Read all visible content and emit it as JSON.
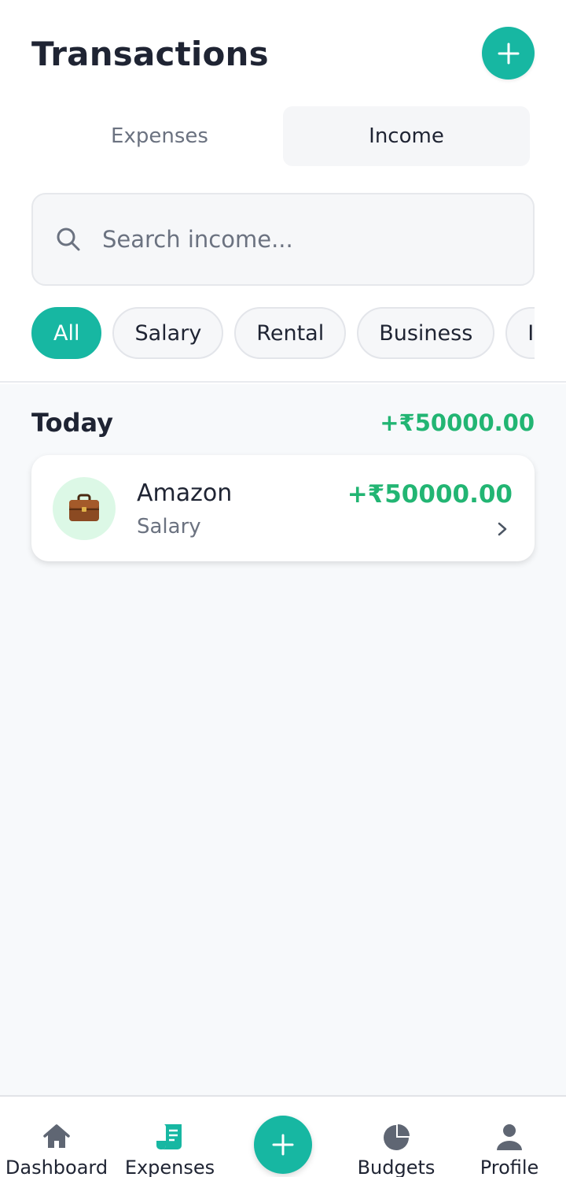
{
  "header": {
    "title": "Transactions",
    "add_icon": "plus-icon"
  },
  "tabs": [
    {
      "label": "Expenses",
      "active": false
    },
    {
      "label": "Income",
      "active": true
    }
  ],
  "search": {
    "placeholder": "Search income...",
    "value": "",
    "icon": "search-icon"
  },
  "filters": [
    {
      "label": "All",
      "active": true
    },
    {
      "label": "Salary",
      "active": false
    },
    {
      "label": "Rental",
      "active": false
    },
    {
      "label": "Business",
      "active": false
    },
    {
      "label": "In",
      "active": false
    }
  ],
  "groups": [
    {
      "title": "Today",
      "total": "+₹50000.00",
      "transactions": [
        {
          "name": "Amazon",
          "category": "Salary",
          "amount": "+₹50000.00",
          "icon": "briefcase-icon"
        }
      ]
    }
  ],
  "bottom_nav": [
    {
      "label": "Dashboard",
      "icon": "home-icon",
      "active": false
    },
    {
      "label": "Expenses",
      "icon": "receipt-icon",
      "active": true
    },
    {
      "label": "",
      "icon": "plus-icon",
      "active": false
    },
    {
      "label": "Budgets",
      "icon": "pie-chart-icon",
      "active": false
    },
    {
      "label": "Profile",
      "icon": "user-icon",
      "active": false
    }
  ],
  "colors": {
    "accent": "#17b7a2",
    "income": "#22b573",
    "text": "#1f2433",
    "muted": "#6b7280"
  }
}
